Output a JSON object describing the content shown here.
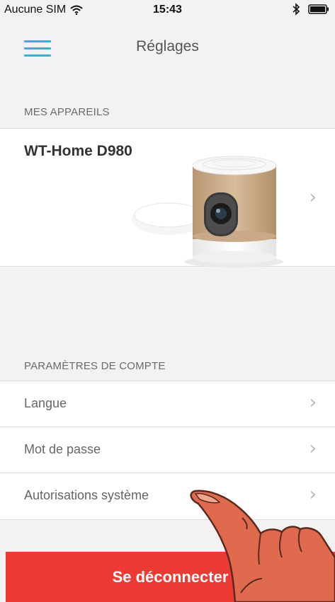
{
  "status_bar": {
    "carrier": "Aucune SIM",
    "time": "15:43",
    "wifi_icon": "wifi-icon",
    "bluetooth_icon": "bluetooth-icon",
    "battery_icon": "battery-icon"
  },
  "nav": {
    "title": "Réglages",
    "menu_icon": "hamburger-menu-icon",
    "accent_color": "#2db2e7"
  },
  "devices": {
    "section_title": "MES APPAREILS",
    "items": [
      {
        "name": "WT-Home D980",
        "chevron": "›"
      }
    ]
  },
  "account": {
    "section_title": "PARAMÈTRES DE COMPTE",
    "items": [
      {
        "label": "Langue",
        "chevron": "›"
      },
      {
        "label": "Mot de passe",
        "chevron": "›"
      },
      {
        "label": "Autorisations système",
        "chevron": "›"
      }
    ]
  },
  "logout": {
    "label": "Se déconnecter",
    "color": "#ee3a33"
  },
  "overlay": {
    "pointer_icon": "hand-pointer-icon"
  }
}
